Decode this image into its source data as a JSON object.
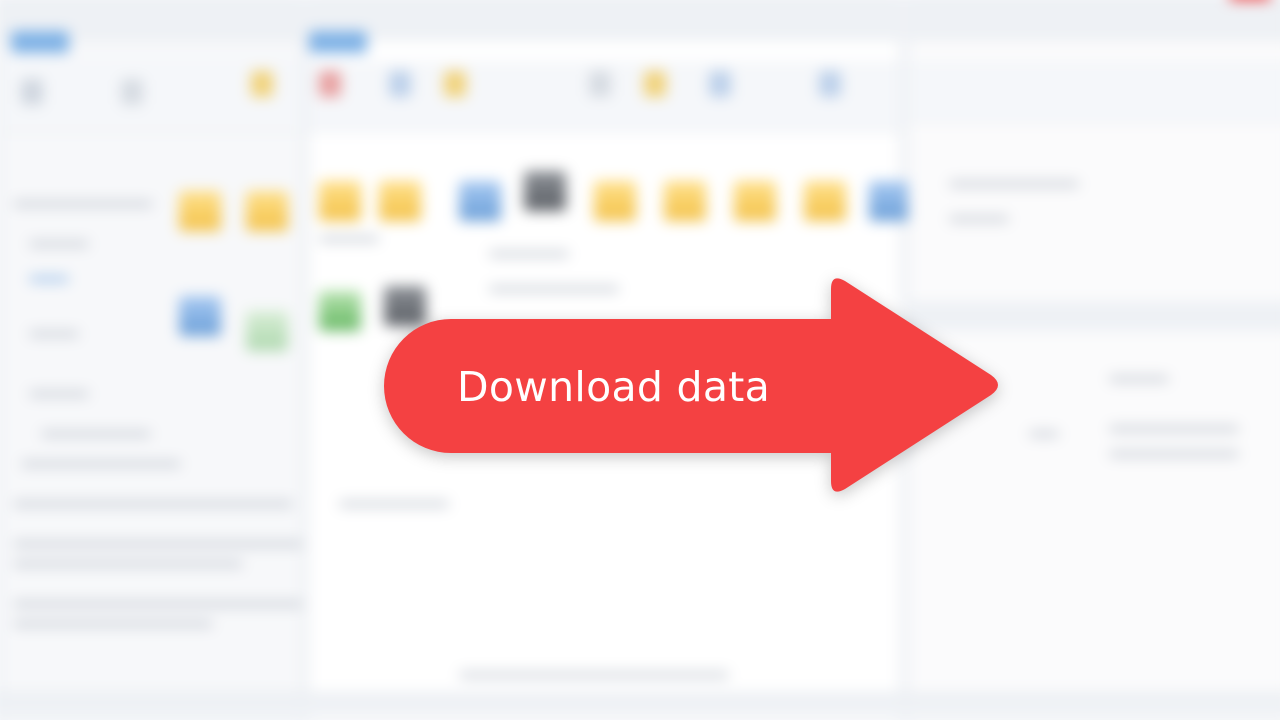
{
  "callout": {
    "label": "Download data",
    "color": "#f44142",
    "text_color": "#ffffff",
    "icon": "right-arrow-icon"
  },
  "background": {
    "state": "blurred",
    "window_close_color": "#ef4444"
  }
}
